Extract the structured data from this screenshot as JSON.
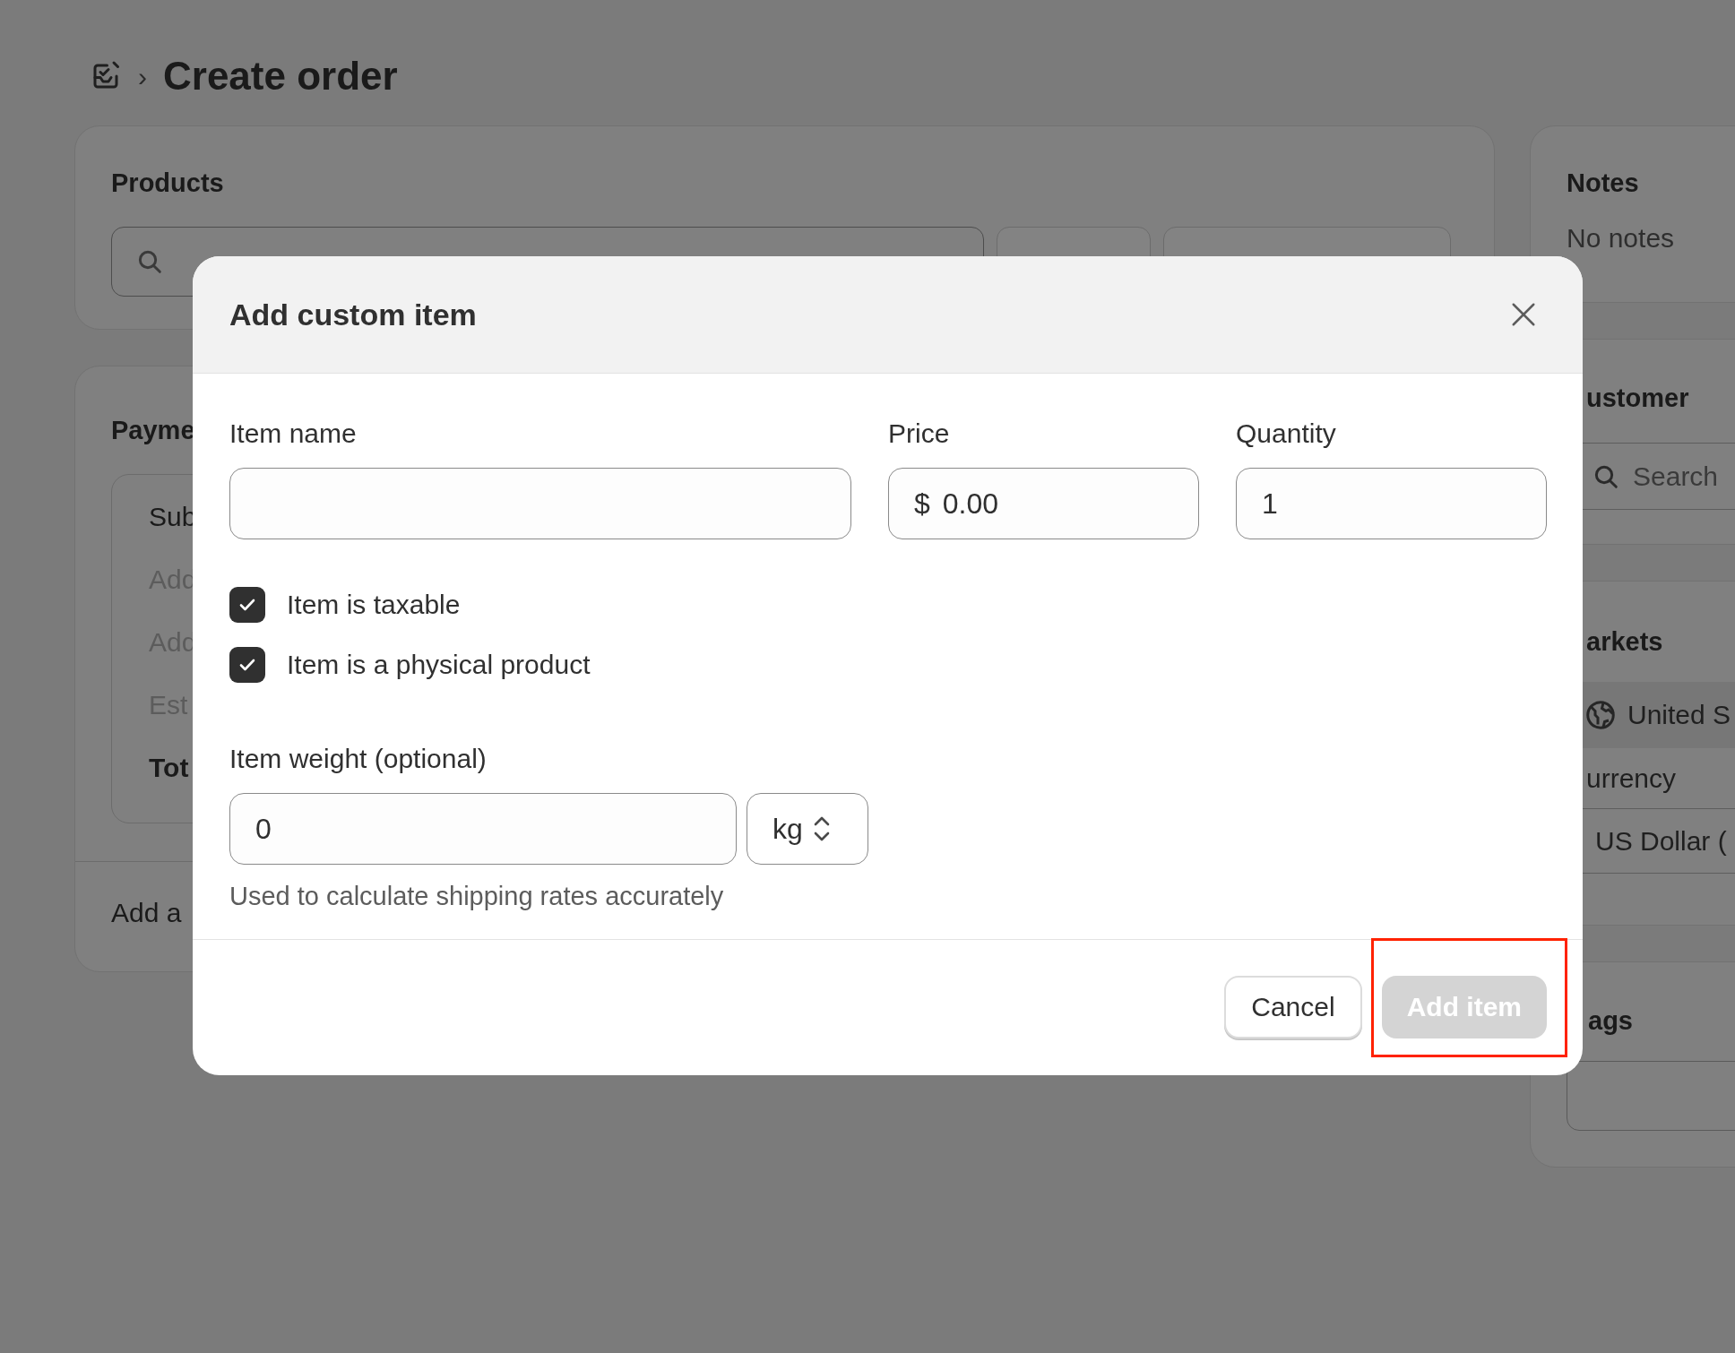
{
  "page": {
    "separator": "›",
    "title": "Create order"
  },
  "products": {
    "title": "Products"
  },
  "payment": {
    "title": "Payme",
    "rows": [
      {
        "label": "Sub",
        "kind": "normal"
      },
      {
        "label": "Add",
        "kind": "muted"
      },
      {
        "label": "Add",
        "kind": "muted"
      },
      {
        "label": "Est",
        "kind": "muted"
      },
      {
        "label": "Tot",
        "kind": "total"
      }
    ],
    "footer": "Add a"
  },
  "notes": {
    "title": "Notes",
    "text": "No notes"
  },
  "customer": {
    "title": "ustomer",
    "search": {
      "placeholder": "Search"
    }
  },
  "markets": {
    "title": "arkets",
    "market": "United S",
    "currency_label": "urrency",
    "currency": "US Dollar ("
  },
  "tags": {
    "title": "ags"
  },
  "modal": {
    "title": "Add custom item",
    "item_name": {
      "label": "Item name"
    },
    "price": {
      "label": "Price",
      "prefix": "$",
      "value": "0.00"
    },
    "quantity": {
      "label": "Quantity",
      "value": "1"
    },
    "checkboxes": [
      {
        "label": "Item is taxable",
        "checked": true
      },
      {
        "label": "Item is a physical product",
        "checked": true
      }
    ],
    "weight": {
      "label": "Item weight (optional)",
      "value": "0",
      "unit": "kg",
      "help": "Used to calculate shipping rates accurately"
    },
    "buttons": [
      {
        "label": "Cancel",
        "kind": "secondary",
        "disabled": false
      },
      {
        "label": "Add item",
        "kind": "primary",
        "disabled": true,
        "highlighted": true
      }
    ]
  }
}
